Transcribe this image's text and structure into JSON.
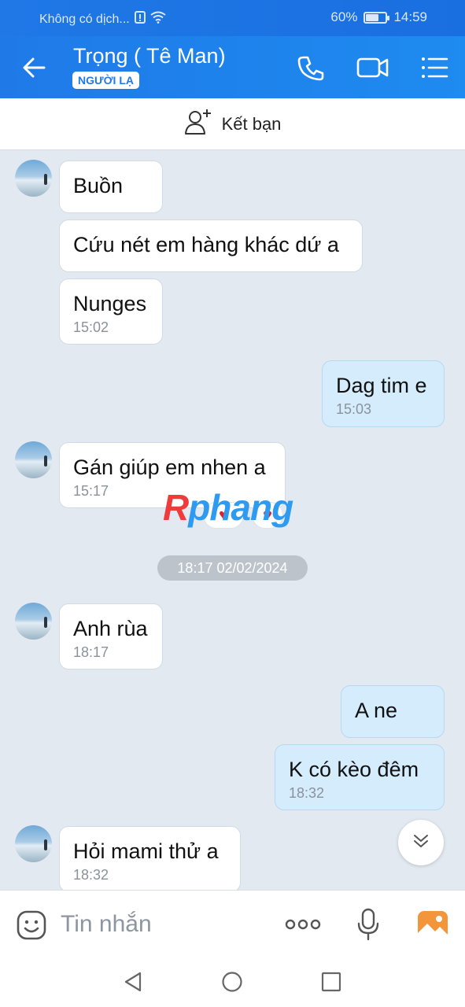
{
  "status": {
    "carrier": "Không có dịch...",
    "battery": "60%",
    "battery_level": 0.6,
    "time": "14:59"
  },
  "header": {
    "title": "Trọng ( Tê Man)",
    "badge": "NGƯỜI LẠ"
  },
  "add_friend": {
    "label": "Kết bạn"
  },
  "watermark": {
    "first": "R",
    "rest": "phang"
  },
  "messages": [
    {
      "text": "Buồn",
      "time": ""
    },
    {
      "text": "Cứu nét em hàng khác dứ a",
      "time": ""
    },
    {
      "text": "Nunges",
      "time": "15:02"
    },
    {
      "text": "Dag tim e",
      "time": "15:03"
    },
    {
      "text": "Gán giúp em nhen a",
      "time": "15:17"
    },
    {
      "text": "Anh rùa",
      "time": "18:17"
    },
    {
      "text": "A ne",
      "time": ""
    },
    {
      "text": "K có kèo đêm",
      "time": "18:32"
    },
    {
      "text": "Hỏi mami thử a",
      "time": "18:32"
    }
  ],
  "date_divider": "18:17 02/02/2024",
  "input": {
    "placeholder": "Tin nhắn"
  },
  "colors": {
    "accent": "#1f7ae8",
    "my_bubble": "#d5ecfd",
    "heart": "#e0202e"
  }
}
